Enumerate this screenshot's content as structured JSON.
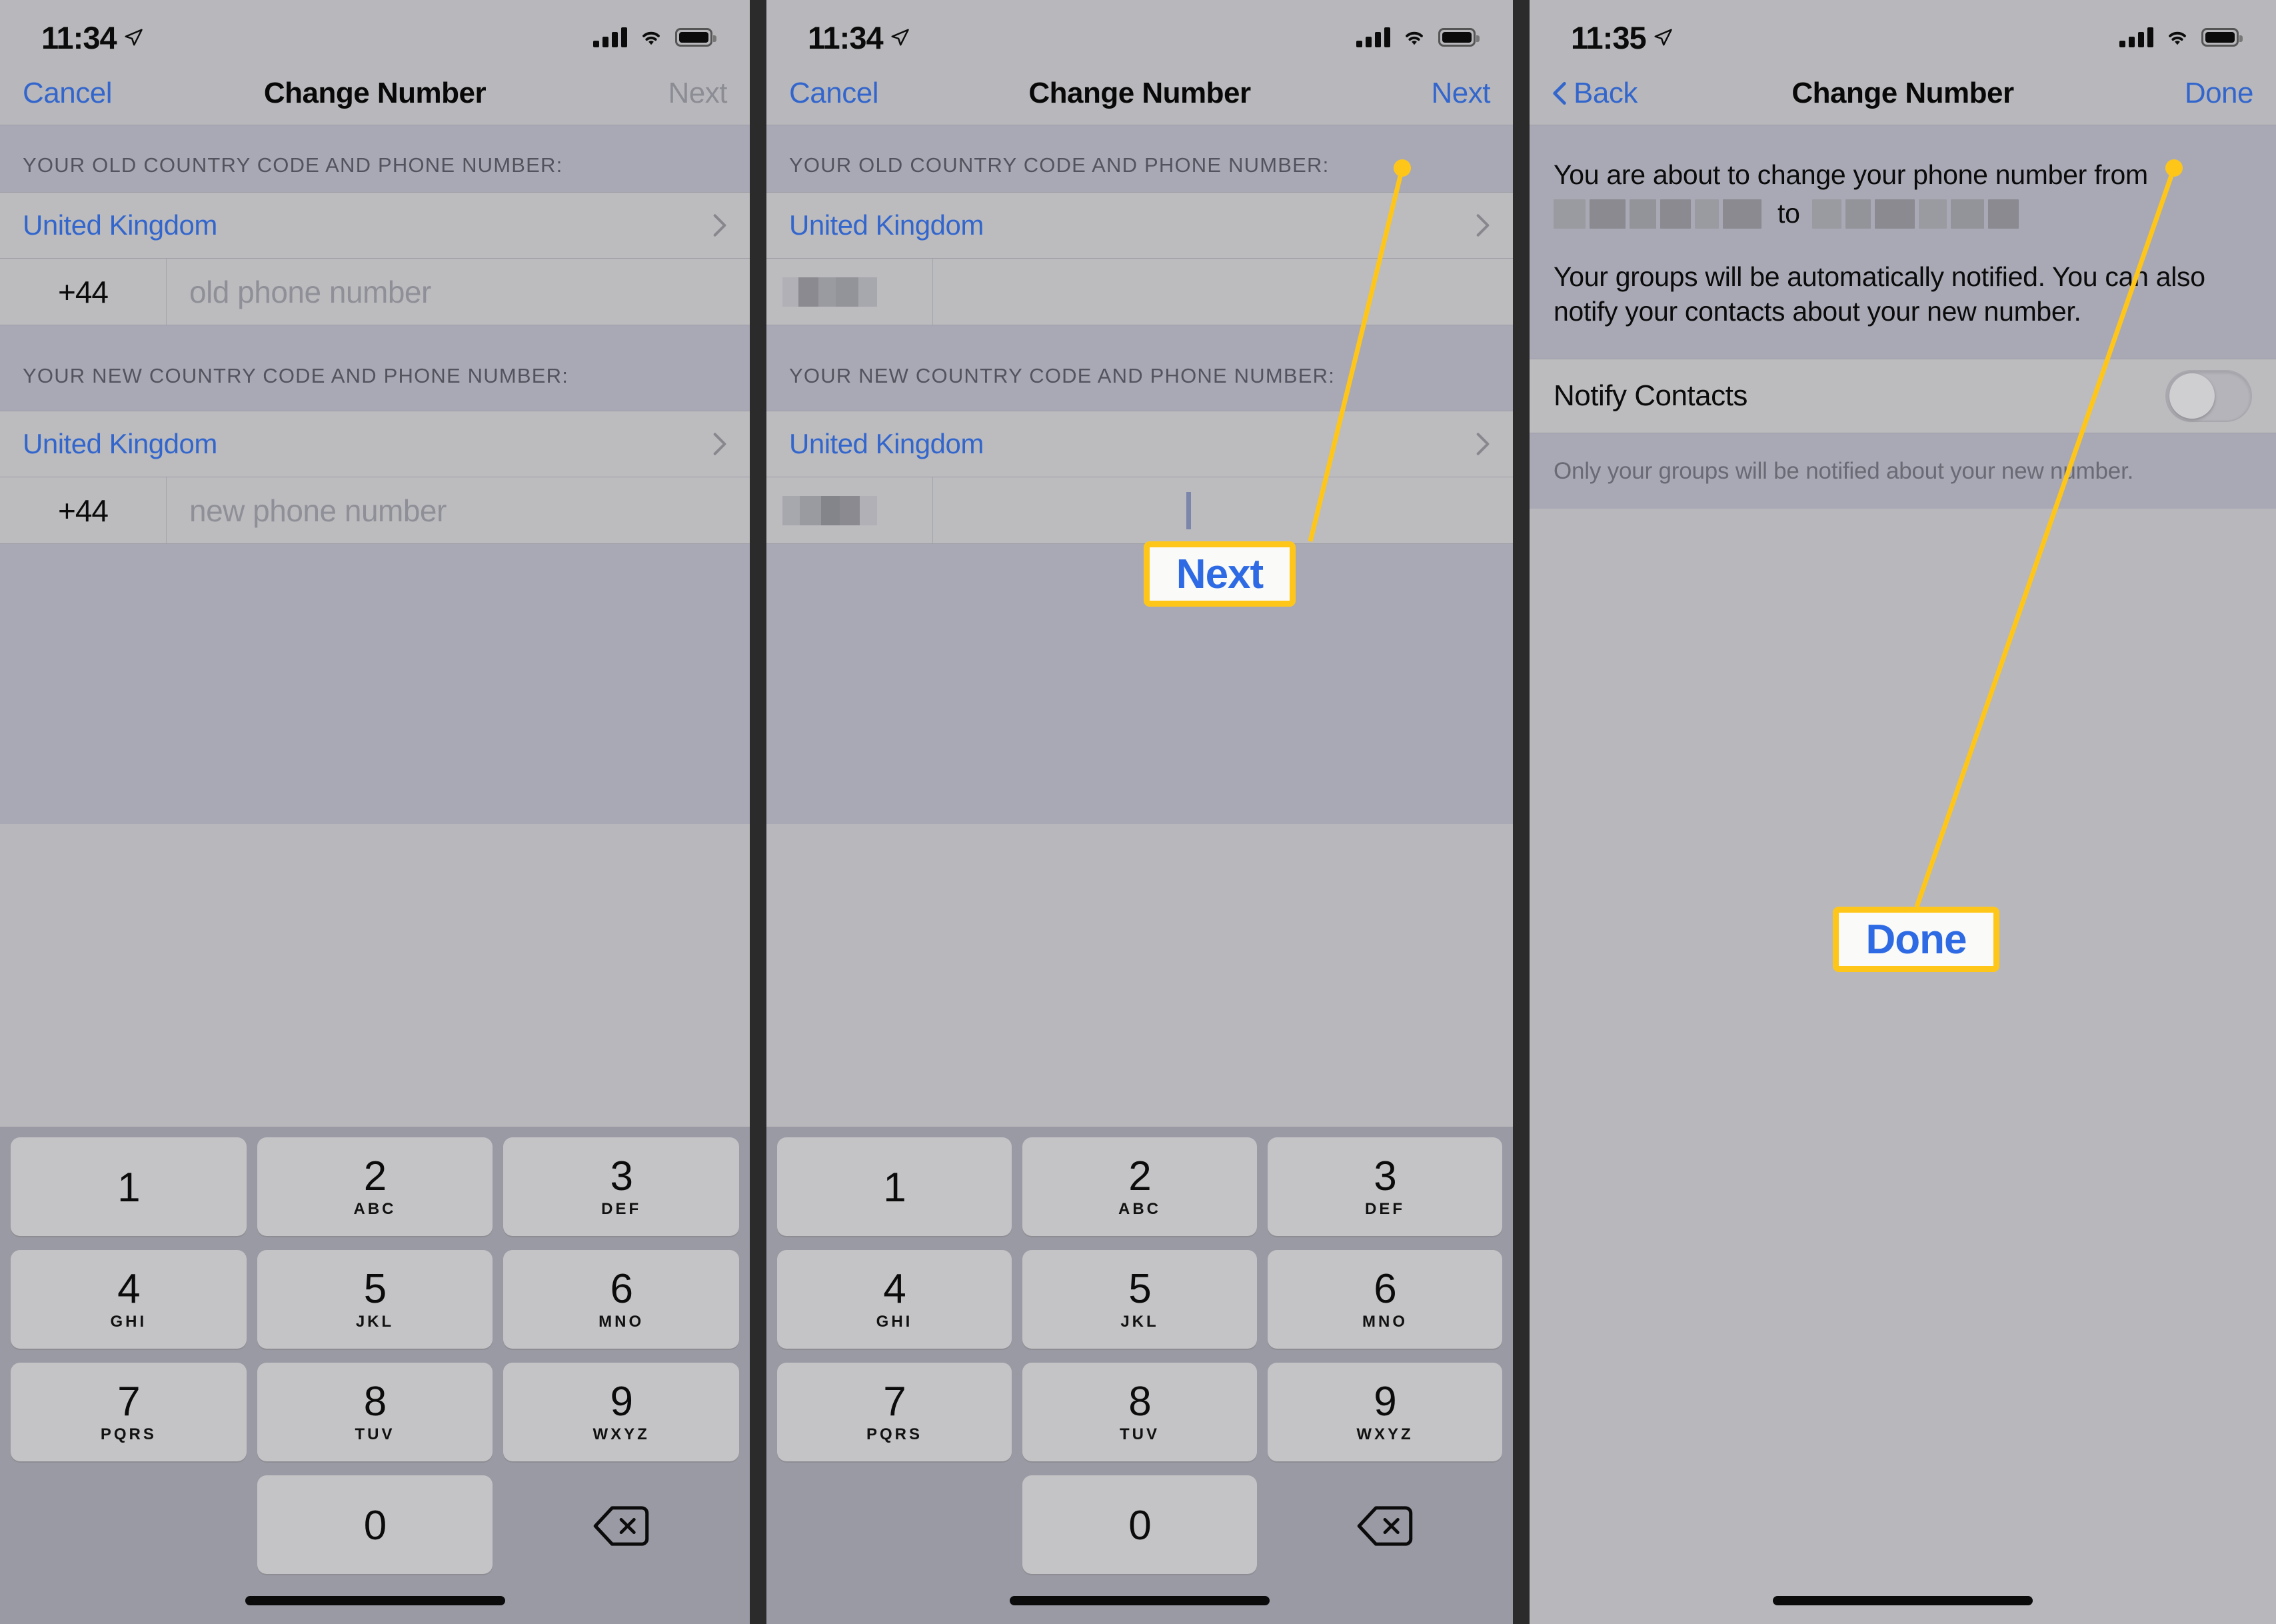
{
  "screens": [
    {
      "id": "screen-1",
      "status": {
        "time": "11:34",
        "location_icon": "location-arrow-icon",
        "signal_icon": "cellular-signal-icon",
        "wifi_icon": "wifi-icon",
        "battery_icon": "battery-full-icon"
      },
      "nav": {
        "left": "Cancel",
        "title": "Change Number",
        "right": "Next",
        "right_disabled": true
      },
      "old_section_header": "YOUR OLD COUNTRY CODE AND PHONE NUMBER:",
      "old_country": "United Kingdom",
      "old_code": "+44",
      "old_placeholder": "old phone number",
      "new_section_header": "YOUR NEW COUNTRY CODE AND PHONE NUMBER:",
      "new_country": "United Kingdom",
      "new_code": "+44",
      "new_placeholder": "new phone number"
    },
    {
      "id": "screen-2",
      "status": {
        "time": "11:34"
      },
      "nav": {
        "left": "Cancel",
        "title": "Change Number",
        "right": "Next",
        "right_disabled": false
      },
      "old_section_header": "YOUR OLD COUNTRY CODE AND PHONE NUMBER:",
      "old_country": "United Kingdom",
      "new_section_header": "YOUR NEW COUNTRY CODE AND PHONE NUMBER:",
      "new_country": "United Kingdom"
    },
    {
      "id": "screen-3",
      "status": {
        "time": "11:35"
      },
      "nav": {
        "left": "Back",
        "title": "Change Number",
        "right": "Done",
        "right_disabled": false
      },
      "intro_line_1": "You are about to change your phone number from",
      "intro_to": "to",
      "intro_line_2": "Your groups will be automatically notified. You can also notify your contacts about your new number.",
      "toggle_label": "Notify Contacts",
      "toggle_state": "off",
      "footnote": "Only your groups will be notified about your new number."
    }
  ],
  "keypad": {
    "keys": [
      {
        "digit": "1",
        "letters": ""
      },
      {
        "digit": "2",
        "letters": "ABC"
      },
      {
        "digit": "3",
        "letters": "DEF"
      },
      {
        "digit": "4",
        "letters": "GHI"
      },
      {
        "digit": "5",
        "letters": "JKL"
      },
      {
        "digit": "6",
        "letters": "MNO"
      },
      {
        "digit": "7",
        "letters": "PQRS"
      },
      {
        "digit": "8",
        "letters": "TUV"
      },
      {
        "digit": "9",
        "letters": "WXYZ"
      },
      {
        "digit": "0",
        "letters": ""
      }
    ],
    "delete_icon": "backspace-delete-icon"
  },
  "callouts": {
    "next": "Next",
    "done": "Done"
  },
  "colors": {
    "accent_blue": "#3366cc",
    "callout_yellow": "#ffc61a",
    "callout_text_blue": "#2d6ae3",
    "background_gray": "#b8b8bc",
    "group_gray": "#a9a9b6"
  }
}
